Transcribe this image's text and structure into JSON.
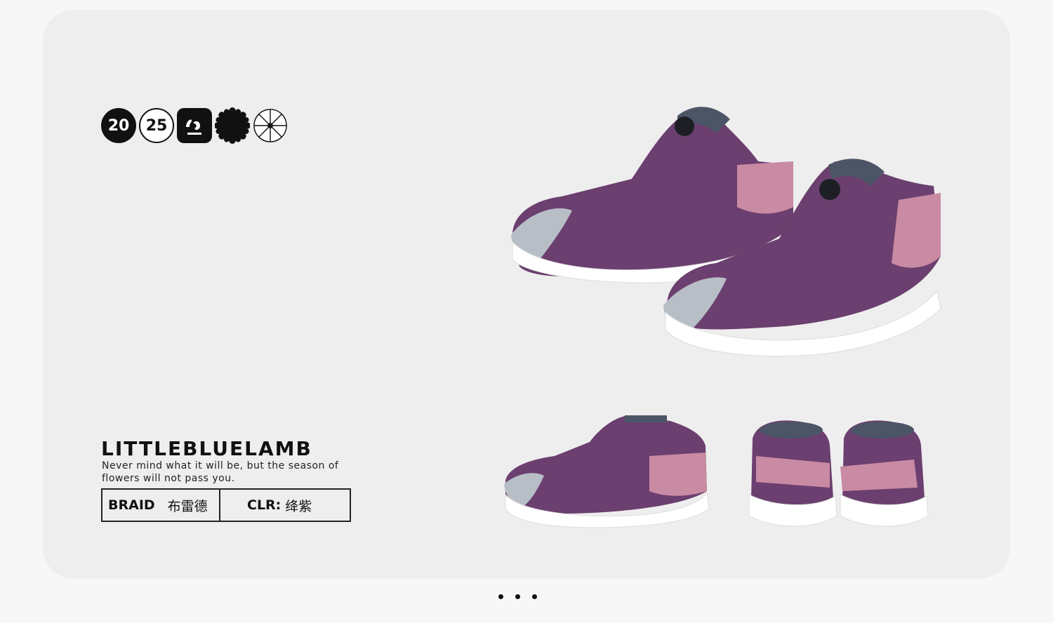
{
  "badges": [
    {
      "text": "20",
      "style": "dark"
    },
    {
      "text": "25",
      "style": "light"
    },
    {
      "icon": "shoe-print-icon",
      "style": "square"
    },
    {
      "icon": "scalloped-seal-icon",
      "style": "dark"
    },
    {
      "icon": "snowflake-icon",
      "style": "outline"
    }
  ],
  "brand": {
    "name": "LITTLEBLUELAMB",
    "tagline": "Never mind what it will be, but the season of flowers will not pass you."
  },
  "spec": {
    "braid_key": "BRAID",
    "braid_value": "布雷德",
    "color_key": "CLR:",
    "color_value": "绛紫"
  },
  "colors": {
    "shoe_purple": "#6b3f6f",
    "shoe_pink": "#c98aa3",
    "sole": "#ffffff",
    "accent": "#b8bec6"
  },
  "carousel": {
    "pages": 3
  }
}
